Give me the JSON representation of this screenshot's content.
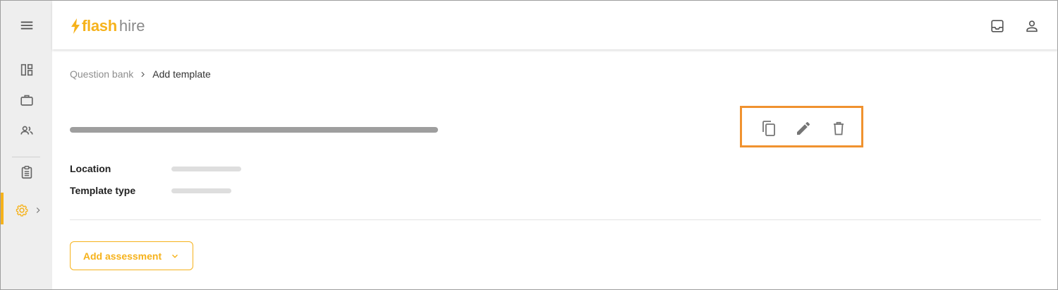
{
  "brand": {
    "name_primary": "flash",
    "name_secondary": "hire",
    "accent_color": "#f6b21b",
    "bolt_icon": "lightning-icon"
  },
  "sidebar": {
    "menu_icon": "hamburger-menu-icon",
    "items": [
      {
        "name": "dashboard",
        "icon": "dashboard-icon"
      },
      {
        "name": "jobs",
        "icon": "briefcase-icon"
      },
      {
        "name": "candidates",
        "icon": "people-icon"
      },
      {
        "name": "question-bank",
        "icon": "clipboard-icon"
      },
      {
        "name": "settings",
        "icon": "gear-icon",
        "active": true
      }
    ]
  },
  "topbar": {
    "icons": [
      "inbox-icon",
      "account-icon"
    ]
  },
  "breadcrumb": {
    "parent": "Question bank",
    "current": "Add template"
  },
  "actions": {
    "icons": [
      "copy-icon",
      "edit-pencil-icon",
      "delete-trash-icon"
    ],
    "highlight_color": "#f0922f"
  },
  "fields": [
    {
      "label": "Location",
      "value": ""
    },
    {
      "label": "Template type",
      "value": ""
    }
  ],
  "add_assessment": {
    "label": "Add assessment"
  }
}
